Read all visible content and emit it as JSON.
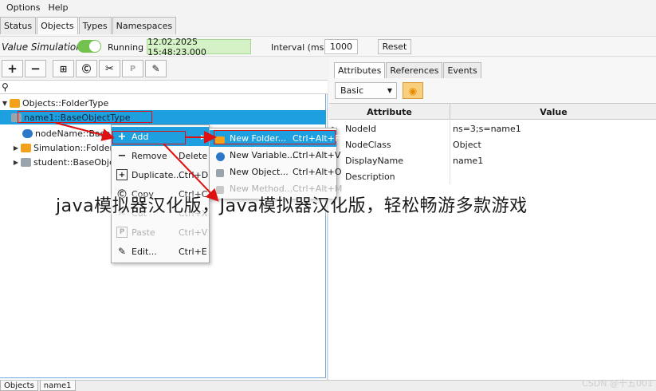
{
  "menu": [
    "Options",
    "Help"
  ],
  "tabs": [
    "Status",
    "Objects",
    "Types",
    "Namespaces"
  ],
  "active_tab": "Objects",
  "simulation": {
    "label": "Value Simulation",
    "toggle_on": true,
    "state": "Running",
    "time": "12.02.2025 15:48:23.000",
    "interval_label": "Interval (ms):",
    "interval_value": "1000",
    "reset_label": "Reset"
  },
  "toolbar": [
    "add-icon",
    "remove-icon",
    "duplicate-icon",
    "copy-icon",
    "cut-icon",
    "paste-icon",
    "edit-icon"
  ],
  "tree": {
    "nodes": [
      {
        "label": "Objects::FolderType",
        "icon": "folder-icon",
        "expanded": true
      },
      {
        "label": "name1::BaseObjectType",
        "icon": "object-icon",
        "selected": true
      },
      {
        "label": "nodeName::BaseDataV",
        "icon": "variable-icon"
      },
      {
        "label": "Simulation::FolderTy",
        "icon": "folder-icon"
      },
      {
        "label": "student::BaseObject",
        "icon": "object-icon"
      }
    ]
  },
  "context_menu": {
    "items": [
      {
        "label": "Add",
        "shortcut": "",
        "icon": "plus-icon",
        "highlighted": true,
        "submenu": true
      },
      {
        "label": "Remove",
        "shortcut": "Delete",
        "icon": "minus-icon"
      },
      {
        "label": "Duplicate...",
        "shortcut": "Ctrl+D",
        "icon": "duplicate-icon"
      },
      {
        "label": "Copy",
        "shortcut": "Ctrl+C",
        "icon": "copy-icon"
      },
      {
        "label": "Cut",
        "shortcut": "Ctrl+X",
        "icon": "cut-icon",
        "disabled": true
      },
      {
        "label": "Paste",
        "shortcut": "Ctrl+V",
        "icon": "paste-icon",
        "disabled": true
      },
      {
        "label": "Edit...",
        "shortcut": "Ctrl+E",
        "icon": "edit-icon"
      }
    ]
  },
  "submenu": {
    "items": [
      {
        "label": "New Folder...",
        "shortcut": "Ctrl+Alt+F",
        "icon": "folder-icon",
        "highlighted": true
      },
      {
        "label": "New Variable...",
        "shortcut": "Ctrl+Alt+V",
        "icon": "variable-icon"
      },
      {
        "label": "New Object...",
        "shortcut": "Ctrl+Alt+O",
        "icon": "object-icon"
      },
      {
        "label": "New Method...",
        "shortcut": "Ctrl+Alt+M",
        "icon": "method-icon",
        "disabled": true
      }
    ]
  },
  "right": {
    "tabs": [
      "Attributes",
      "References",
      "Events"
    ],
    "active_tab": "Attributes",
    "view_select": "Basic",
    "columns": [
      "Attribute",
      "Value"
    ],
    "rows": [
      {
        "attribute": "NodeId",
        "value": "ns=3;s=name1",
        "expandable": true
      },
      {
        "attribute": "NodeClass",
        "value": "Object",
        "expandable": false
      },
      {
        "attribute": "DisplayName",
        "value": "name1",
        "expandable": true
      },
      {
        "attribute": "Description",
        "value": "",
        "expandable": true
      }
    ]
  },
  "bottom_tabs": [
    "Objects",
    "name1"
  ],
  "watermark_text": "java模拟器汉化版，Java模拟器汉化版，轻松畅游多款游戏",
  "credit": "CSDN @十五001",
  "colors": {
    "selection": "#1e9fe0",
    "running_toggle": "#73c24e",
    "time_bg": "#d4f2c6",
    "annotation": "#dd1111"
  }
}
